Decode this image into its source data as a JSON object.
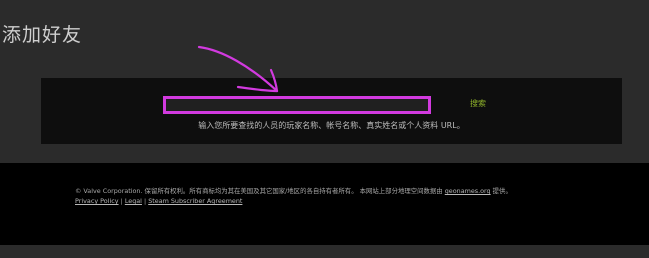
{
  "page": {
    "title": "添加好友"
  },
  "search": {
    "value": "",
    "button_label": "搜索",
    "help_text": "输入您所要查找的人员的玩家名称、帐号名称、真实姓名或个人资料 URL。"
  },
  "footer": {
    "copyright_text": "© Valve Corporation. 保留所有权利。所有商标均为其在美国及其它国家/地区的各自持有者所有。 本网站上部分地理空间数据由",
    "geonames_link": "geonames.org",
    "copyright_suffix": "提供。",
    "links": {
      "privacy": "Privacy Policy",
      "legal": "Legal",
      "subscriber": "Steam Subscriber Agreement"
    },
    "separator": "|"
  },
  "annotation": {
    "color": "#d23adf",
    "icon": "hand-drawn-arrow-icon"
  },
  "colors": {
    "page_background": "#2b2b2b",
    "panel_background": "#0e0e0e",
    "footer_background": "#000000",
    "search_button": "#8fb22a",
    "highlight": "#d23adf"
  }
}
